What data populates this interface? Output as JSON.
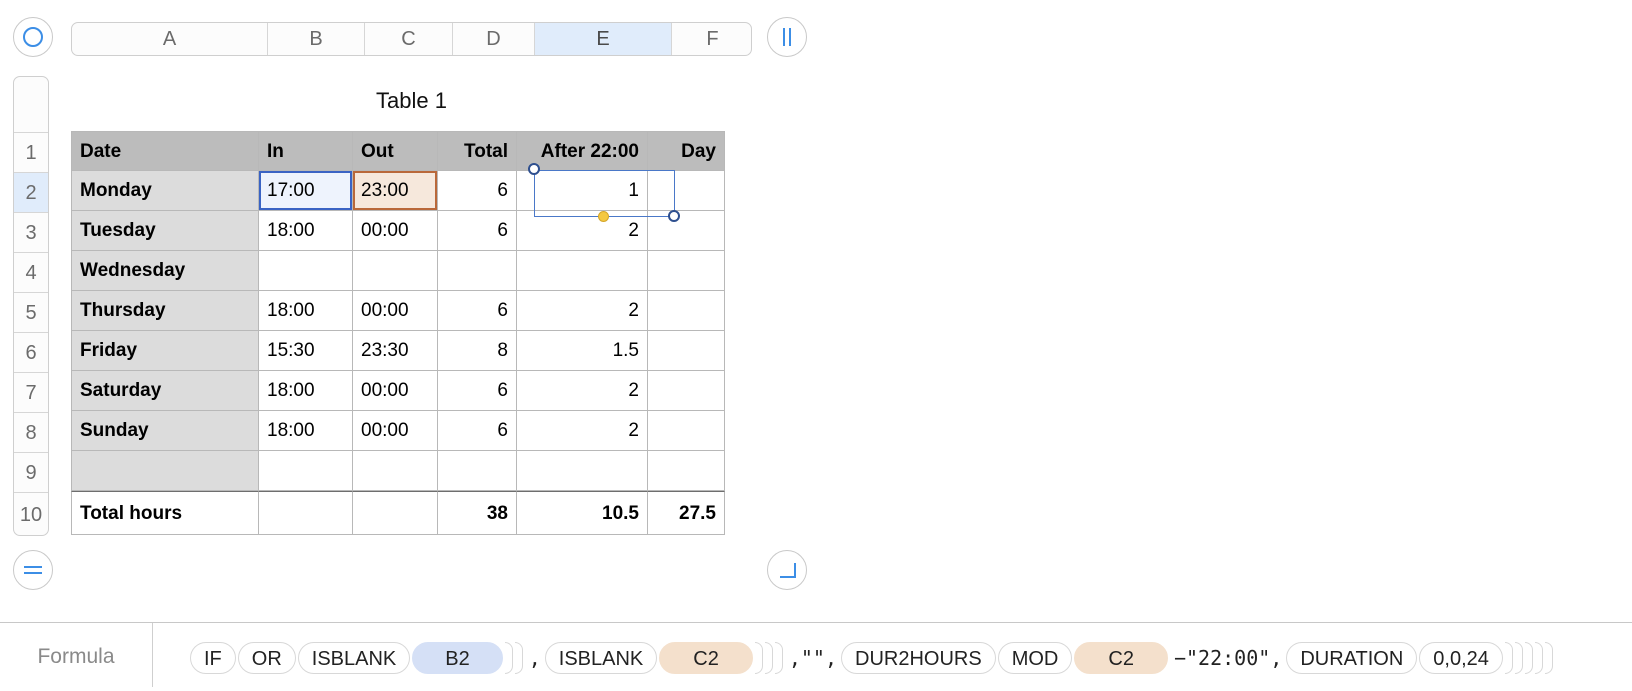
{
  "table": {
    "title": "Table 1"
  },
  "columns": [
    "A",
    "B",
    "C",
    "D",
    "E",
    "F"
  ],
  "selected_column": "E",
  "rows": [
    "1",
    "2",
    "3",
    "4",
    "5",
    "6",
    "7",
    "8",
    "9",
    "10"
  ],
  "selected_row": "2",
  "header": [
    "Date",
    "In",
    "Out",
    "Total",
    "After 22:00",
    "Day"
  ],
  "body": [
    [
      "Monday",
      "17:00",
      "23:00",
      "6",
      "1",
      ""
    ],
    [
      "Tuesday",
      "18:00",
      "00:00",
      "6",
      "2",
      ""
    ],
    [
      "Wednesday",
      "",
      "",
      "",
      "",
      ""
    ],
    [
      "Thursday",
      "18:00",
      "00:00",
      "6",
      "2",
      ""
    ],
    [
      "Friday",
      "15:30",
      "23:30",
      "8",
      "1.5",
      ""
    ],
    [
      "Saturday",
      "18:00",
      "00:00",
      "6",
      "2",
      ""
    ],
    [
      "Sunday",
      "18:00",
      "00:00",
      "6",
      "2",
      ""
    ],
    [
      "",
      "",
      "",
      "",
      "",
      ""
    ]
  ],
  "footer": [
    "Total hours",
    "",
    "",
    "38",
    "10.5",
    "27.5"
  ],
  "formula": {
    "label": "Formula",
    "tokens": {
      "if": "IF",
      "or": "OR",
      "isblank1": "ISBLANK",
      "ref_b2": "B2",
      "comma1": ",",
      "isblank2": "ISBLANK",
      "ref_c2": "C2",
      "empty_str": ",\"\",",
      "dur2hours": "DUR2HOURS",
      "mod": "MOD",
      "ref_c2b": "C2",
      "minus_time": "−\"22:00\",",
      "duration": "DURATION",
      "duration_args": "0,0,24"
    }
  },
  "colors": {
    "header_fill": "#bcbcbc",
    "label_fill": "#dcdcdc",
    "ref_b_color": "#3a63c4",
    "ref_c_color": "#b9683a",
    "selection_color": "#4a78c8"
  }
}
